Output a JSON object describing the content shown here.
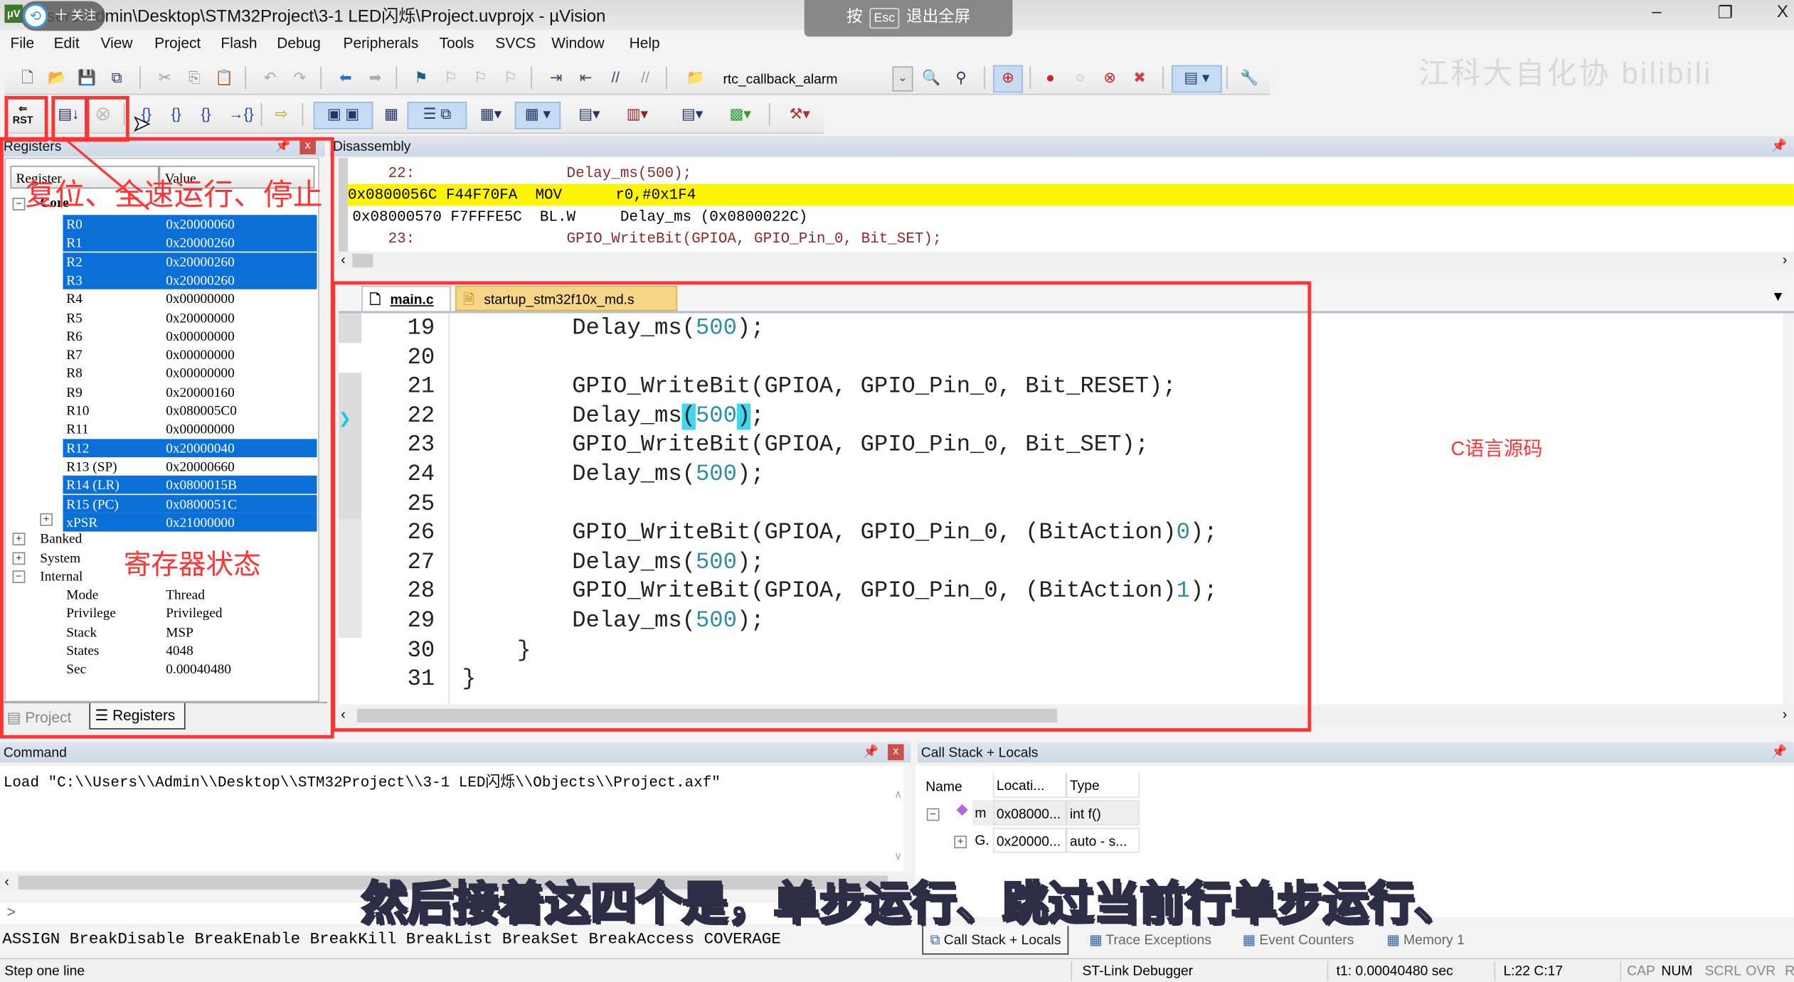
{
  "window": {
    "title": "C:\\Users\\Admin\\Desktop\\STM32Project\\3-1 LED闪烁\\Project.uvprojx - µVision",
    "title_visible": "Users\\Admin\\Desktop\\STM32Project\\3-1 LED闪烁\\Project.uvprojx - µVision",
    "minimize": "–",
    "restore": "❐",
    "close": "X"
  },
  "overlay": {
    "follow_label": "十 关注",
    "esc_hint_prefix": "按",
    "esc_key": "Esc",
    "esc_hint_suffix": "退出全屏",
    "watermark": "江科大自化协 bilibili",
    "subtitle": "然后接着这四个是，单步运行、跳过当前行单步运行、"
  },
  "menu": [
    "File",
    "Edit",
    "View",
    "Project",
    "Flash",
    "Debug",
    "Peripherals",
    "Tools",
    "SVCS",
    "Window",
    "Help"
  ],
  "toolbar1": {
    "target_combo": "rtc_callback_alarm"
  },
  "toolbar2": {
    "rst_label": "RST"
  },
  "annotations": {
    "toolbar_note": "复位、全速运行、停止",
    "registers_note": "寄存器状态",
    "source_note": "C语言源码"
  },
  "registers": {
    "title": "Registers",
    "col_register": "Register",
    "col_value": "Value",
    "core_label": "Core",
    "core": [
      {
        "name": "R0",
        "value": "0x20000060",
        "selected": true
      },
      {
        "name": "R1",
        "value": "0x20000260",
        "selected": true
      },
      {
        "name": "R2",
        "value": "0x20000260",
        "selected": true
      },
      {
        "name": "R3",
        "value": "0x20000260",
        "selected": true
      },
      {
        "name": "R4",
        "value": "0x00000000",
        "selected": false
      },
      {
        "name": "R5",
        "value": "0x20000000",
        "selected": false
      },
      {
        "name": "R6",
        "value": "0x00000000",
        "selected": false
      },
      {
        "name": "R7",
        "value": "0x00000000",
        "selected": false
      },
      {
        "name": "R8",
        "value": "0x00000000",
        "selected": false
      },
      {
        "name": "R9",
        "value": "0x20000160",
        "selected": false
      },
      {
        "name": "R10",
        "value": "0x080005C0",
        "selected": false
      },
      {
        "name": "R11",
        "value": "0x00000000",
        "selected": false
      },
      {
        "name": "R12",
        "value": "0x20000040",
        "selected": true
      },
      {
        "name": "R13 (SP)",
        "value": "0x20000660",
        "selected": false
      },
      {
        "name": "R14 (LR)",
        "value": "0x0800015B",
        "selected": true
      },
      {
        "name": "R15 (PC)",
        "value": "0x0800051C",
        "selected": true
      },
      {
        "name": "xPSR",
        "value": "0x21000000",
        "selected": true
      }
    ],
    "groups": [
      "Banked",
      "System",
      "Internal"
    ],
    "internal": [
      {
        "name": "Mode",
        "value": "Thread"
      },
      {
        "name": "Privilege",
        "value": "Privileged"
      },
      {
        "name": "Stack",
        "value": "MSP"
      },
      {
        "name": "States",
        "value": "4048"
      },
      {
        "name": "Sec",
        "value": "0.00040480"
      }
    ],
    "tabs": [
      "Project",
      "Registers"
    ],
    "active_tab": "Registers"
  },
  "disassembly": {
    "title": "Disassembly",
    "lines": [
      {
        "kind": "src",
        "text": "    22:                 Delay_ms(500);"
      },
      {
        "kind": "cur",
        "text": "0x0800056C F44F70FA  MOV      r0,#0x1F4"
      },
      {
        "kind": "asm",
        "text": "0x08000570 F7FFFE5C  BL.W     Delay_ms (0x0800022C)"
      },
      {
        "kind": "src",
        "text": "    23:                 GPIO_WriteBit(GPIOA, GPIO_Pin_0, Bit_SET);"
      }
    ]
  },
  "editor": {
    "tabs": [
      {
        "label": "main.c",
        "active": true
      },
      {
        "label": "startup_stm32f10x_md.s",
        "active": false
      }
    ],
    "current_line": 22,
    "lines": [
      {
        "n": "19",
        "pre": "        Delay_ms(",
        "num": "500",
        "post": ");"
      },
      {
        "n": "20",
        "pre": "",
        "num": "",
        "post": ""
      },
      {
        "n": "21",
        "pre": "        GPIO_WriteBit(GPIOA, GPIO_Pin_0, Bit_RESET);",
        "num": "",
        "post": ""
      },
      {
        "n": "22",
        "pre": "        Delay_ms",
        "num": "500",
        "post": ";",
        "bracket": true
      },
      {
        "n": "23",
        "pre": "        GPIO_WriteBit(GPIOA, GPIO_Pin_0, Bit_SET);",
        "num": "",
        "post": ""
      },
      {
        "n": "24",
        "pre": "        Delay_ms(",
        "num": "500",
        "post": ");"
      },
      {
        "n": "25",
        "pre": "",
        "num": "",
        "post": ""
      },
      {
        "n": "26",
        "pre": "        GPIO_WriteBit(GPIOA, GPIO_Pin_0, (BitAction)",
        "num": "0",
        "post": ");"
      },
      {
        "n": "27",
        "pre": "        Delay_ms(",
        "num": "500",
        "post": ");"
      },
      {
        "n": "28",
        "pre": "        GPIO_WriteBit(GPIOA, GPIO_Pin_0, (BitAction)",
        "num": "1",
        "post": ");"
      },
      {
        "n": "29",
        "pre": "        Delay_ms(",
        "num": "500",
        "post": ");"
      },
      {
        "n": "30",
        "pre": "    }",
        "num": "",
        "post": ""
      },
      {
        "n": "31",
        "pre": "}",
        "num": "",
        "post": ""
      }
    ]
  },
  "command": {
    "title": "Command",
    "output": "Load \"C:\\\\Users\\\\Admin\\\\Desktop\\\\STM32Project\\\\3-1 LED闪烁\\\\Objects\\\\Project.axf\"",
    "prompt": ">",
    "input_value": "",
    "help": "ASSIGN BreakDisable BreakEnable BreakKill BreakList BreakSet BreakAccess COVERAGE"
  },
  "callstack": {
    "title": "Call Stack + Locals",
    "columns": [
      "Name",
      "Locati...",
      "Type"
    ],
    "rows": [
      {
        "name": "m",
        "location": "0x08000...",
        "type": "int f()"
      },
      {
        "name": "G.",
        "location": "0x20000...",
        "type": "auto - s..."
      }
    ],
    "tabs": [
      "Call Stack + Locals",
      "Trace Exceptions",
      "Event Counters",
      "Memory 1"
    ]
  },
  "status": {
    "hint": "Step one line",
    "debugger": "ST-Link Debugger",
    "time": "t1: 0.00040480 sec",
    "position": "L:22 C:17",
    "cap": "CAP",
    "num": "NUM",
    "scrl": "SCRL",
    "ovr": "OVR",
    "rw": "R"
  },
  "colors": {
    "selection": "#0a6fd6",
    "current_line": "#fef500",
    "annotation": "#ff3333",
    "number_literal": "#2b8fa8",
    "bracket_match": "#3fd7f0"
  }
}
